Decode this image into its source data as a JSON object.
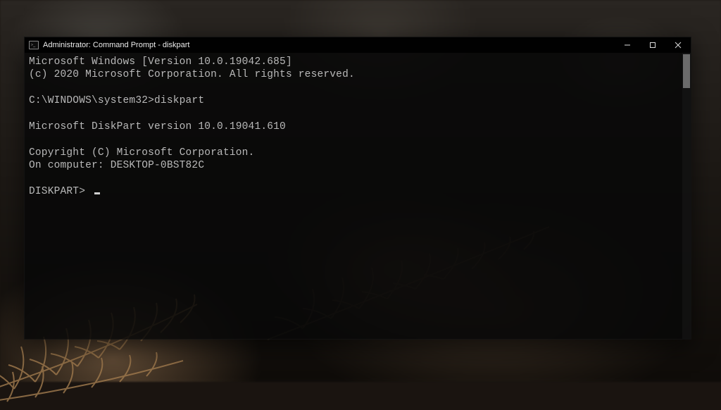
{
  "window": {
    "title": "Administrator: Command Prompt - diskpart"
  },
  "terminal": {
    "lines": [
      "Microsoft Windows [Version 10.0.19042.685]",
      "(c) 2020 Microsoft Corporation. All rights reserved.",
      "",
      "C:\\WINDOWS\\system32>diskpart",
      "",
      "Microsoft DiskPart version 10.0.19041.610",
      "",
      "Copyright (C) Microsoft Corporation.",
      "On computer: DESKTOP-0BST82C",
      "",
      "DISKPART> "
    ]
  }
}
